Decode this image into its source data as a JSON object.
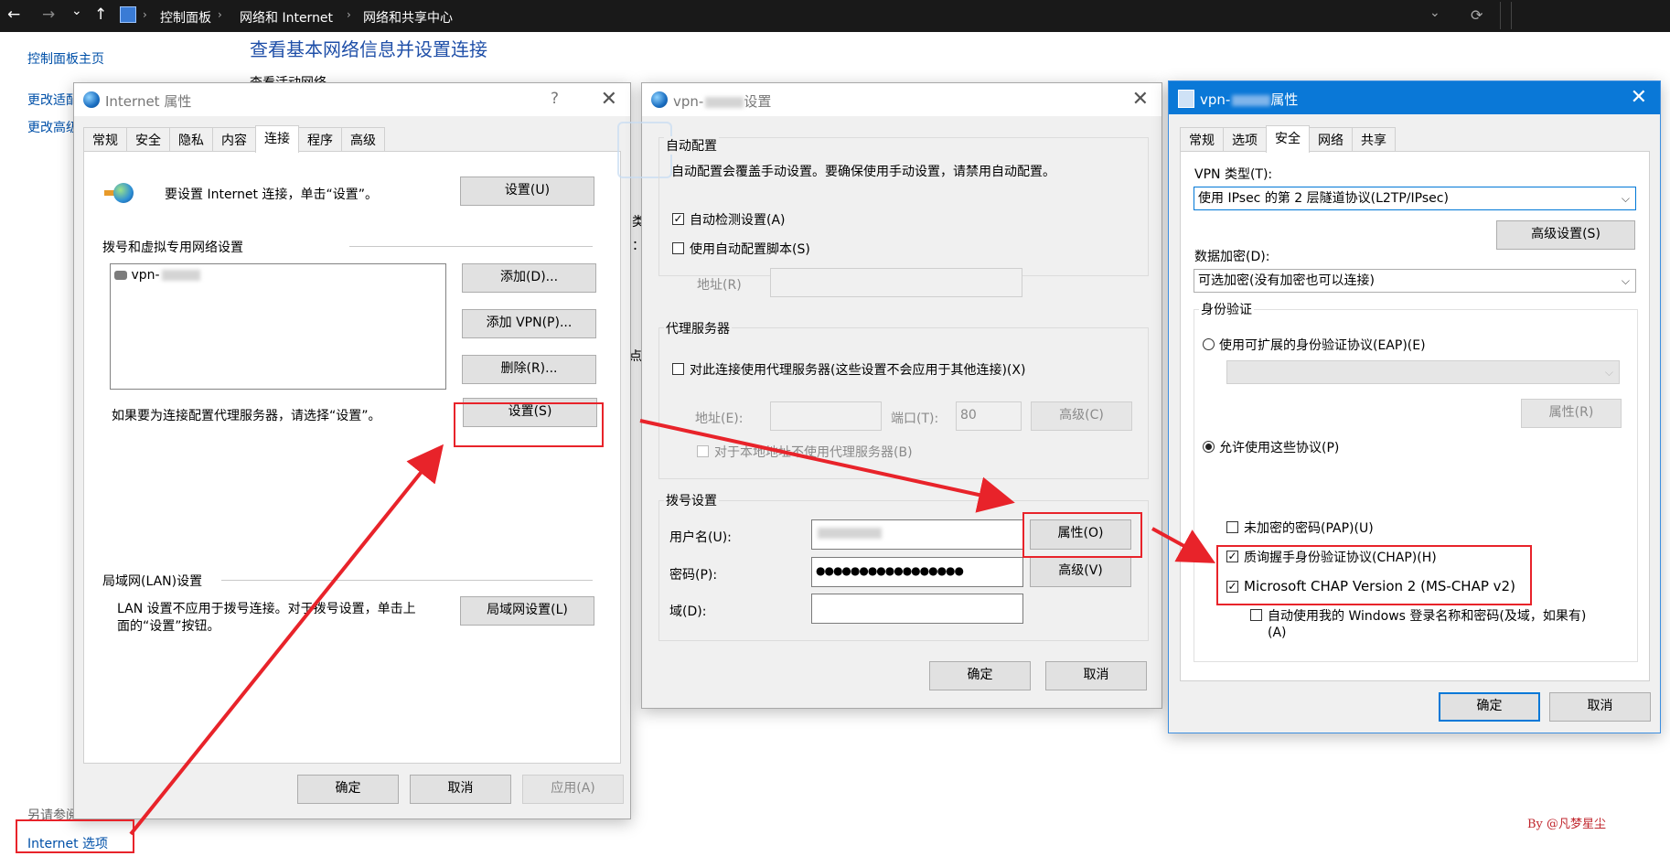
{
  "explorer": {
    "breadcrumb": [
      "控制面板",
      "网络和 Internet",
      "网络和共享中心"
    ],
    "nav_back": "←",
    "nav_forward": "→",
    "nav_recent": "⌄",
    "nav_up": "↑",
    "dropdown": "⌄",
    "refresh": "⟳"
  },
  "control_panel": {
    "home_link": "控制面板主页",
    "link_adapter": "更改适配",
    "link_advanced": "更改高级",
    "heading": "查看基本网络信息并设置连接",
    "subheading": "查看活动网络",
    "see_also": "另请参阅",
    "internet_options": "Internet 选项",
    "frag1": "类",
    "frag2": "：",
    "frag3": "点。"
  },
  "internet_props": {
    "title": "Internet 属性",
    "help": "?",
    "close": "✕",
    "tabs": [
      "常规",
      "安全",
      "隐私",
      "内容",
      "连接",
      "程序",
      "高级"
    ],
    "selected_tab": "连接",
    "setup_text": "要设置 Internet 连接，单击“设置”。",
    "setup_button": "设置(U)",
    "dialup_section": "拨号和虚拟专用网络设置",
    "vpn_item": "vpn-",
    "add_button": "添加(D)...",
    "add_vpn_button": "添加 VPN(P)...",
    "remove_button": "删除(R)...",
    "proxy_text": "如果要为连接配置代理服务器，请选择“设置”。",
    "settings_button": "设置(S)",
    "lan_section": "局域网(LAN)设置",
    "lan_text_line1": "LAN 设置不应用于拨号连接。对于拨号设置，单击上",
    "lan_text_line2": "面的“设置”按钮。",
    "lan_button": "局域网设置(L)",
    "ok": "确定",
    "cancel": "取消",
    "apply": "应用(A)"
  },
  "vpn_settings": {
    "title_prefix": "vpn-",
    "title_suffix": "设置",
    "close": "✕",
    "auto_config_group": "自动配置",
    "auto_config_desc": "自动配置会覆盖手动设置。要确保使用手动设置，请禁用自动配置。",
    "auto_detect": "自动检测设置(A)",
    "auto_detect_checked": true,
    "use_script": "使用自动配置脚本(S)",
    "use_script_checked": false,
    "address_label": "地址(R)",
    "proxy_group": "代理服务器",
    "use_proxy": "对此连接使用代理服务器(这些设置不会应用于其他连接)(X)",
    "proxy_address_label": "地址(E):",
    "port_label": "端口(T):",
    "port_value": "80",
    "advanced_c": "高级(C)",
    "bypass_local": "对于本地地址不使用代理服务器(B)",
    "dialup_group": "拨号设置",
    "username_label": "用户名(U):",
    "password_label": "密码(P):",
    "password_value": "●●●●●●●●●●●●●●●●●",
    "domain_label": "域(D):",
    "properties_button": "属性(O)",
    "advanced_v": "高级(V)",
    "ok": "确定",
    "cancel": "取消"
  },
  "vpn_props": {
    "title_prefix": "vpn-",
    "title_suffix": "属性",
    "close": "✕",
    "tabs": [
      "常规",
      "选项",
      "安全",
      "网络",
      "共享"
    ],
    "selected_tab": "安全",
    "vpn_type_label": "VPN 类型(T):",
    "vpn_type_value": "使用 IPsec 的第 2 层隧道协议(L2TP/IPsec)",
    "advanced_settings": "高级设置(S)",
    "encryption_label": "数据加密(D):",
    "encryption_value": "可选加密(没有加密也可以连接)",
    "auth_group": "身份验证",
    "eap_option": "使用可扩展的身份验证协议(EAP)(E)",
    "eap_props": "属性(R)",
    "allow_protocols": "允许使用这些协议(P)",
    "pap": "未加密的密码(PAP)(U)",
    "pap_checked": false,
    "chap": "质询握手身份验证协议(CHAP)(H)",
    "chap_checked": true,
    "mschap": "Microsoft CHAP Version 2 (MS-CHAP v2)",
    "mschap_checked": true,
    "auto_windows_line1": "自动使用我的 Windows 登录名称和密码(及域，如果有)",
    "auto_windows_line2": "(A)",
    "auto_windows_checked": false,
    "ok": "确定",
    "cancel": "取消"
  },
  "annotation": {
    "watermark": "By @凡梦星尘",
    "color": "#e8232a"
  }
}
